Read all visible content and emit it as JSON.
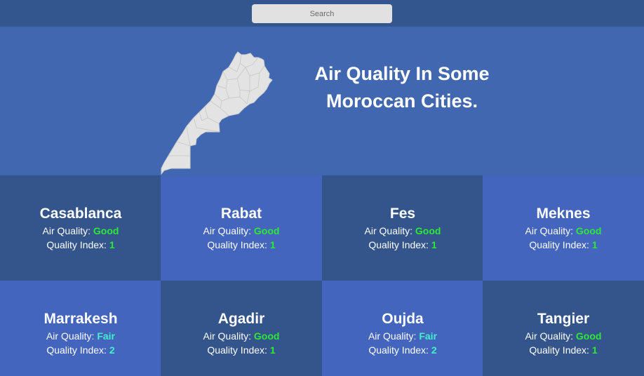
{
  "search": {
    "placeholder": "Search"
  },
  "hero": {
    "title": "Air Quality In Some Moroccan Cities."
  },
  "labels": {
    "air_quality": "Air Quality:",
    "quality_index": "Quality Index:"
  },
  "colors": {
    "good": "#2cea34",
    "fair": "#45f0c8"
  },
  "cities": [
    {
      "name": "Casablanca",
      "quality": "Good",
      "index": "1"
    },
    {
      "name": "Rabat",
      "quality": "Good",
      "index": "1"
    },
    {
      "name": "Fes",
      "quality": "Good",
      "index": "1"
    },
    {
      "name": "Meknes",
      "quality": "Good",
      "index": "1"
    },
    {
      "name": "Marrakesh",
      "quality": "Fair",
      "index": "2"
    },
    {
      "name": "Agadir",
      "quality": "Good",
      "index": "1"
    },
    {
      "name": "Oujda",
      "quality": "Fair",
      "index": "2"
    },
    {
      "name": "Tangier",
      "quality": "Good",
      "index": "1"
    }
  ]
}
